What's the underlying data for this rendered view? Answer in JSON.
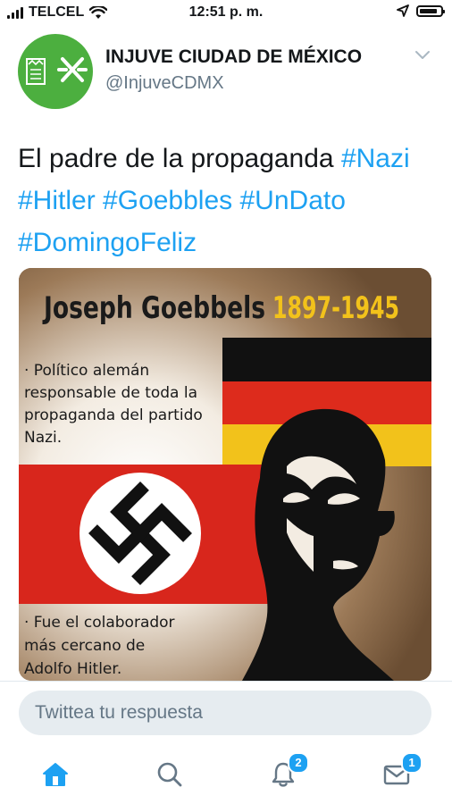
{
  "status_bar": {
    "carrier": "TELCEL",
    "time": "12:51 p. m.",
    "battery_level": 0.85
  },
  "tweet": {
    "author_name": "INJUVE CIUDAD DE MÉXICO",
    "author_handle": "@InjuveCDMX",
    "text_plain": "El padre de la propaganda ",
    "hashtags": [
      "#Nazi",
      "#Hitler",
      "#Goebbles",
      "#UnDato",
      "#DomingoFeliz"
    ]
  },
  "media": {
    "title_name": "Joseph Goebbels",
    "title_years": "1897-1945",
    "fact_1": "· Político alemán responsable de toda la propaganda del partido Nazi.",
    "fact_2": "· Fue el colaborador más cercano de Adolfo Hitler."
  },
  "reply": {
    "placeholder": "Twittea tu respuesta"
  },
  "tab_bar": {
    "tabs": [
      {
        "icon": "home-icon",
        "active": true
      },
      {
        "icon": "search-icon",
        "active": false
      },
      {
        "icon": "bell-icon",
        "badge": "2"
      },
      {
        "icon": "mail-icon",
        "badge": "1"
      }
    ]
  },
  "colors": {
    "accent": "#1da1f2",
    "avatar_bg": "#4caf3f"
  }
}
